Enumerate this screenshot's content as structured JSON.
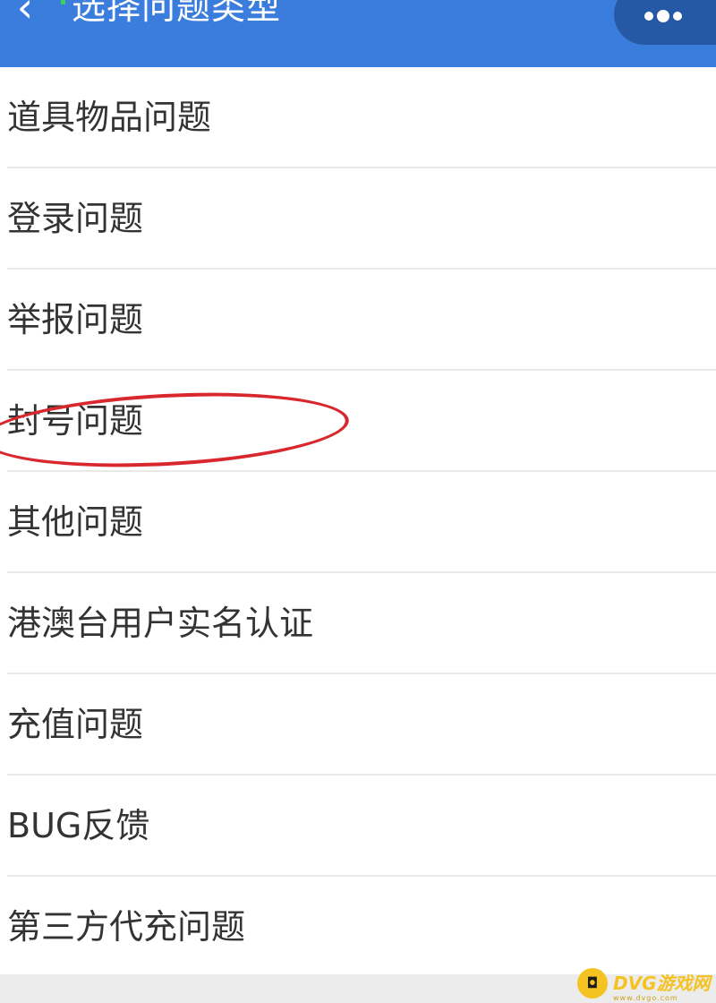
{
  "header": {
    "back_icon": "chevron-left-icon",
    "title": "选择问题类型",
    "menu_icon": "more-dots-icon",
    "background_color": "#3b7ddd"
  },
  "list": {
    "items": [
      {
        "label": "道具物品问题"
      },
      {
        "label": "登录问题"
      },
      {
        "label": "举报问题"
      },
      {
        "label": "封号问题",
        "highlighted": true
      },
      {
        "label": "其他问题"
      },
      {
        "label": "港澳台用户实名认证"
      },
      {
        "label": "充值问题"
      },
      {
        "label": "BUG反馈"
      },
      {
        "label": "第三方代充问题"
      }
    ]
  },
  "annotation": {
    "type": "red-ellipse",
    "target": "封号问题",
    "color": "#d9272e"
  },
  "watermark": {
    "text": "DVG游戏网",
    "sub": "www.dvgo.com",
    "color": "#f5c321"
  }
}
